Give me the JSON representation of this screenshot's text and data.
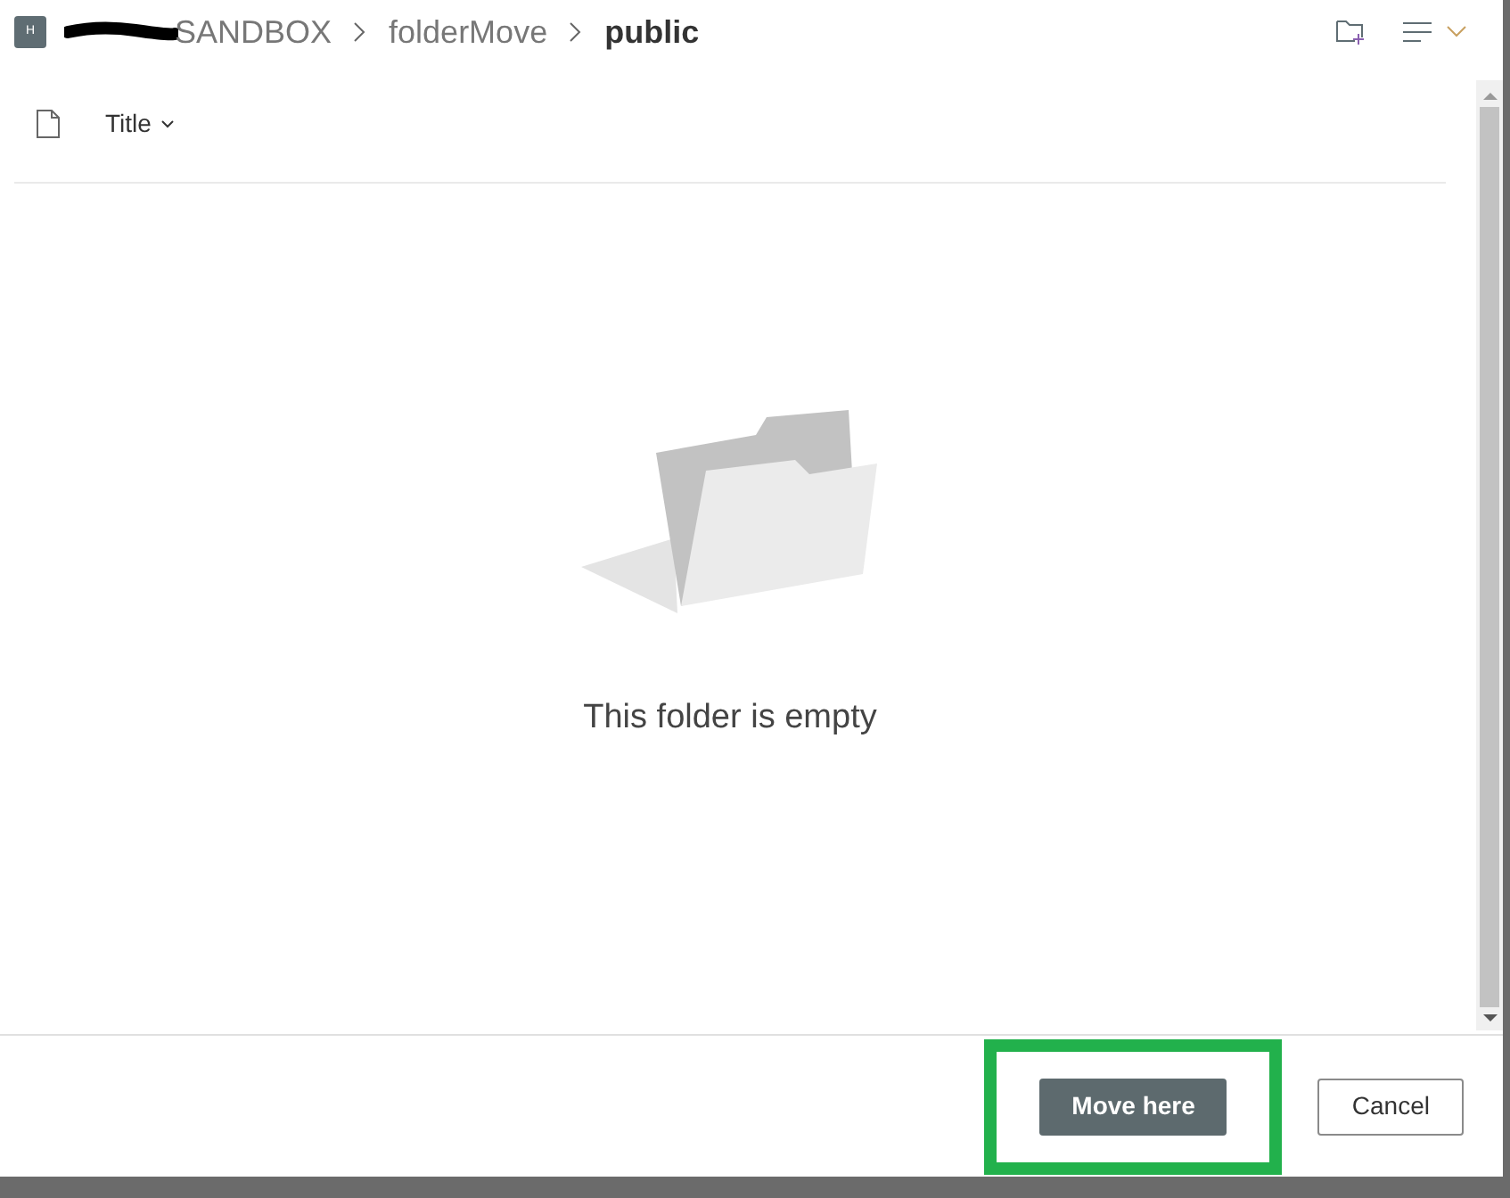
{
  "breadcrumb": {
    "site_initial": "H",
    "items": [
      {
        "label": "SANDBOX",
        "current": false,
        "redacted": true
      },
      {
        "label": "folderMove",
        "current": false,
        "redacted": false
      },
      {
        "label": "public",
        "current": true,
        "redacted": false
      }
    ]
  },
  "list": {
    "columns": [
      {
        "label": "Title"
      }
    ],
    "empty_message": "This folder is empty"
  },
  "footer": {
    "buttons": [
      {
        "label": "Move here",
        "kind": "primary",
        "highlighted": true
      },
      {
        "label": "Cancel",
        "kind": "secondary",
        "highlighted": false
      }
    ]
  }
}
